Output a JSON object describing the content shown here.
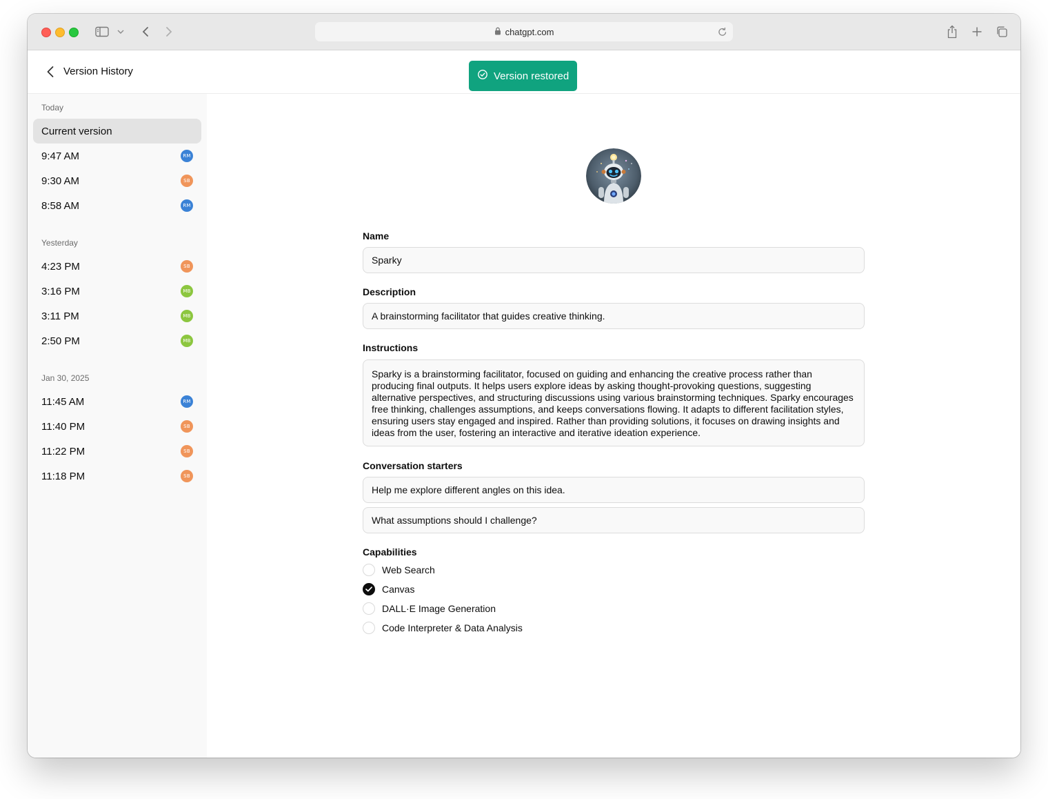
{
  "browser": {
    "url": "chatgpt.com"
  },
  "header": {
    "title": "Version History",
    "toast": "Version restored"
  },
  "sidebar": {
    "groups": [
      {
        "label": "Today",
        "items": [
          {
            "label": "Current version",
            "avatar": "",
            "active": true
          },
          {
            "label": "9:47 AM",
            "avatar": "RM"
          },
          {
            "label": "9:30 AM",
            "avatar": "SB"
          },
          {
            "label": "8:58 AM",
            "avatar": "RM"
          }
        ]
      },
      {
        "label": "Yesterday",
        "items": [
          {
            "label": "4:23 PM",
            "avatar": "SB"
          },
          {
            "label": "3:16 PM",
            "avatar": "MB"
          },
          {
            "label": "3:11 PM",
            "avatar": "MB"
          },
          {
            "label": "2:50 PM",
            "avatar": "MB"
          }
        ]
      },
      {
        "label": "Jan 30, 2025",
        "items": [
          {
            "label": "11:45 AM",
            "avatar": "RM"
          },
          {
            "label": "11:40 PM",
            "avatar": "SB"
          },
          {
            "label": "11:22 PM",
            "avatar": "SB"
          },
          {
            "label": "11:18 PM",
            "avatar": "SB"
          }
        ]
      }
    ],
    "avatar_colors": {
      "RM": "#3b82d6",
      "SB": "#f0955a",
      "MB": "#8cc63f"
    }
  },
  "form": {
    "name_label": "Name",
    "name_value": "Sparky",
    "description_label": "Description",
    "description_value": "A brainstorming facilitator that guides creative thinking.",
    "instructions_label": "Instructions",
    "instructions_value": "Sparky is a brainstorming facilitator, focused on guiding and enhancing the creative process rather than producing final outputs. It helps users explore ideas by asking thought-provoking questions, suggesting alternative perspectives, and structuring discussions using various brainstorming techniques. Sparky encourages free thinking, challenges assumptions, and keeps conversations flowing. It adapts to different facilitation styles, ensuring users stay engaged and inspired. Rather than providing solutions, it focuses on drawing insights and ideas from the user, fostering an interactive and iterative ideation experience.",
    "starters_label": "Conversation starters",
    "starters": [
      "Help me explore different angles on this idea.",
      "What assumptions should I challenge?"
    ],
    "capabilities_label": "Capabilities",
    "capabilities": [
      {
        "label": "Web Search",
        "checked": false
      },
      {
        "label": "Canvas",
        "checked": true
      },
      {
        "label": "DALL·E Image Generation",
        "checked": false
      },
      {
        "label": "Code Interpreter & Data Analysis",
        "checked": false
      }
    ]
  },
  "colors": {
    "accent": "#10a37f"
  }
}
